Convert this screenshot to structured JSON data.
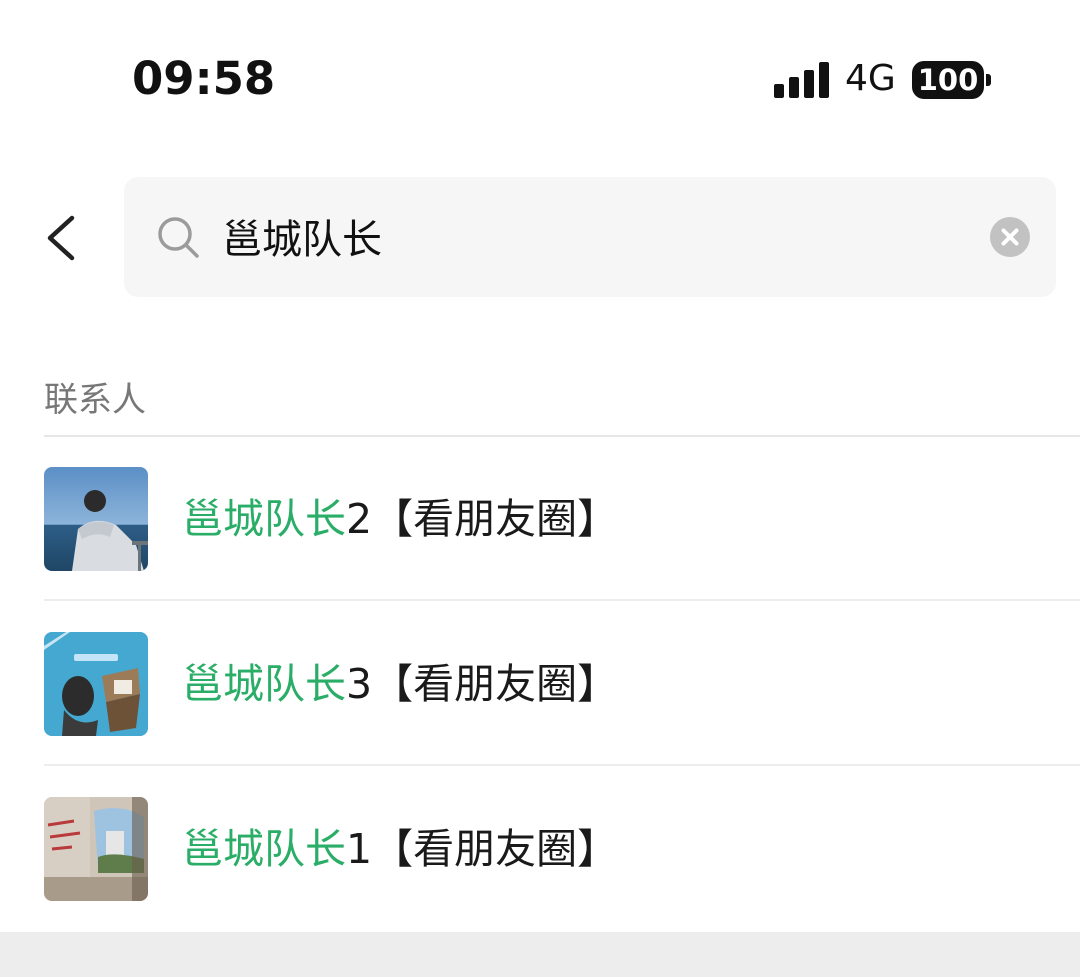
{
  "status_bar": {
    "time": "09:58",
    "network": "4G",
    "battery": "100",
    "signal_icon": "cellular-signal-icon",
    "battery_icon": "battery-icon"
  },
  "header": {
    "back_icon": "chevron-left-icon",
    "search": {
      "icon": "search-icon",
      "value": "邕城队长",
      "clear_icon": "clear-circle-icon"
    }
  },
  "section": {
    "title": "联系人"
  },
  "contacts": [
    {
      "match": "邕城队长",
      "suffix": "2【看朋友圈】",
      "avatar": "photo-person-seaside"
    },
    {
      "match": "邕城队长",
      "suffix": "3【看朋友圈】",
      "avatar": "photo-desk-blue"
    },
    {
      "match": "邕城队长",
      "suffix": "1【看朋友圈】",
      "avatar": "photo-ruined-wall"
    }
  ],
  "colors": {
    "highlight": "#2aae67",
    "text": "#1a1a1a",
    "secondary_text": "#777777",
    "search_bg": "#f6f6f6"
  }
}
